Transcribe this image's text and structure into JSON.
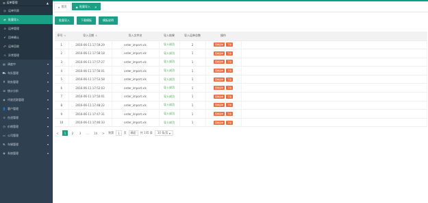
{
  "sidebar": {
    "top": {
      "label": "运单管理"
    },
    "items": [
      {
        "label": "运单列表",
        "type": "sub"
      },
      {
        "label": "批量导入",
        "type": "active"
      },
      {
        "label": "运单管理",
        "type": "sub"
      },
      {
        "label": "回单确认",
        "type": "sub"
      },
      {
        "label": "运单回收",
        "type": "sub"
      },
      {
        "label": "异常管理",
        "type": "sub"
      },
      {
        "label": "调度中",
        "type": "main"
      },
      {
        "label": "车队管理",
        "type": "main"
      },
      {
        "label": "财务管理",
        "type": "main"
      },
      {
        "label": "统计分析",
        "type": "main"
      },
      {
        "label": "代收货款管理",
        "type": "main"
      },
      {
        "label": "客户管理",
        "type": "main"
      },
      {
        "label": "在途管理",
        "type": "main"
      },
      {
        "label": "价格管理",
        "type": "main"
      },
      {
        "label": "公司管理",
        "type": "main"
      },
      {
        "label": "车辆管理",
        "type": "main"
      },
      {
        "label": "系统管理",
        "type": "main"
      }
    ]
  },
  "tabs": [
    {
      "label": "首页",
      "active": false
    },
    {
      "label": "批量导入",
      "active": true
    }
  ],
  "toolbar": {
    "import_label": "批量导入",
    "template_label": "下载模板",
    "help_label": "模板说明"
  },
  "table": {
    "headers": [
      "序号",
      "导入日期",
      "导入文件名",
      "导入结果",
      "导入运单总数",
      "操作"
    ],
    "rows": [
      {
        "no": "1",
        "date": "2016-06-11 17:59:29",
        "file": "order_import.xls",
        "result": "导入成功",
        "count": "2"
      },
      {
        "no": "2",
        "date": "2016-06-11 17:58:18",
        "file": "order_import.xls",
        "result": "导入成功",
        "count": "1"
      },
      {
        "no": "3",
        "date": "2016-06-11 17:57:27",
        "file": "order_import.xls",
        "result": "导入成功",
        "count": "1"
      },
      {
        "no": "4",
        "date": "2016-06-11 17:56:01",
        "file": "order_import.xls",
        "result": "导入成功",
        "count": "1"
      },
      {
        "no": "5",
        "date": "2016-06-11 17:53:58",
        "file": "order_import.xls",
        "result": "导入成功",
        "count": "1"
      },
      {
        "no": "6",
        "date": "2016-06-11 17:52:03",
        "file": "order_import.xls",
        "result": "导入成功",
        "count": "1"
      },
      {
        "no": "7",
        "date": "2016-06-11 17:50:01",
        "file": "order_import.xls",
        "result": "导入成功",
        "count": "1"
      },
      {
        "no": "8",
        "date": "2016-06-11 17:48:22",
        "file": "order_import.xls",
        "result": "导入成功",
        "count": "1"
      },
      {
        "no": "9",
        "date": "2016-06-11 17:47:31",
        "file": "order_import.xls",
        "result": "导入成功",
        "count": "1"
      },
      {
        "no": "10",
        "date": "2016-06-11 17:46:33",
        "file": "order_import.xls",
        "result": "导入成功",
        "count": "1"
      }
    ],
    "op_view": "查看运单",
    "op_download": "下载"
  },
  "pager": {
    "prev": "<",
    "pages": [
      "1",
      "2",
      "3",
      "...",
      "14"
    ],
    "next": ">",
    "goto_label": "到第",
    "goto_value": "1",
    "page_unit": "页",
    "confirm": "确定",
    "total": "共 135 条",
    "per_page": "10 条/页"
  },
  "colors": {
    "accent": "#1aa085",
    "sidebar_bg": "#2f4050",
    "op_button": "#ee6a3c",
    "success_text": "#3ca546"
  }
}
